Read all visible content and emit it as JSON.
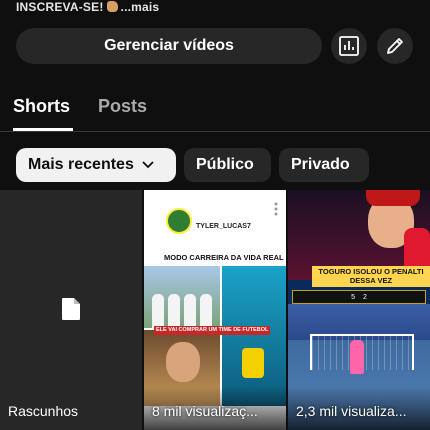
{
  "header": {
    "subscribe_text": "INSCREVA-SE!",
    "more_text": "...mais"
  },
  "actions": {
    "manage_videos_label": "Gerenciar vídeos",
    "analytics_icon": "analytics-icon",
    "edit_icon": "edit-pencil-icon"
  },
  "tabs": [
    {
      "label": "Shorts",
      "selected": true
    },
    {
      "label": "Posts",
      "selected": false
    }
  ],
  "filters": {
    "sort_label": "Mais recentes",
    "public_label": "Público",
    "private_label": "Privado"
  },
  "grid": [
    {
      "label": "Rascunhos",
      "icon": "file-icon"
    },
    {
      "label": "8 mil visualizaç...",
      "channel_handle": "TYLER_LUCAS7",
      "caption": "MODO CARREIRA DA VIDA REAL",
      "tag_text": "ELE VAI COMPRAR UM TIME DE FUTEBOL"
    },
    {
      "label": "2,3 mil visualiza...",
      "headline": "TOGURO ISOLOU O PENALTI DESSA VEZ",
      "score_left": "5",
      "score_right": "2"
    }
  ],
  "colors": {
    "background": "#0f0f0f",
    "chip_dark": "#272727",
    "chip_selected": "#f1f1f1"
  }
}
